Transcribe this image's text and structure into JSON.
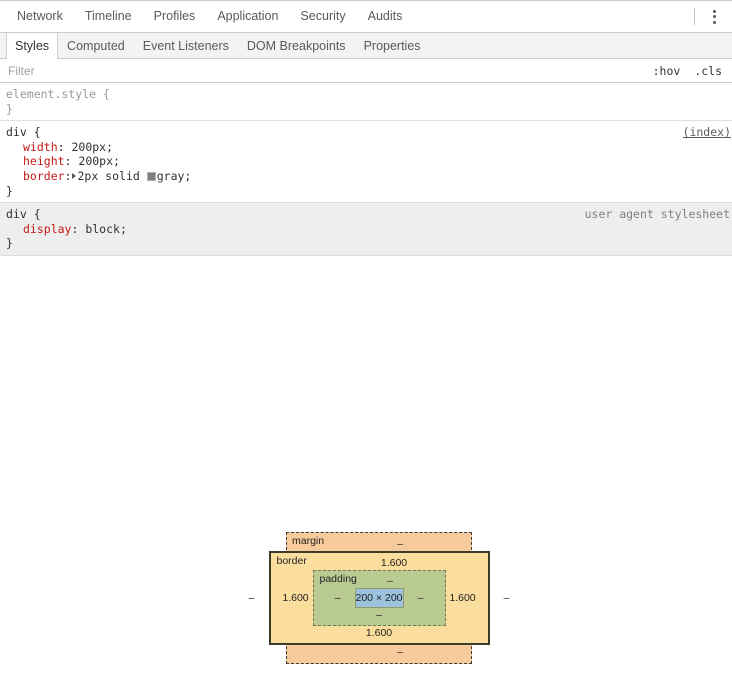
{
  "panel_menu": {
    "items": [
      {
        "label": "Network"
      },
      {
        "label": "Timeline"
      },
      {
        "label": "Profiles"
      },
      {
        "label": "Application"
      },
      {
        "label": "Security"
      },
      {
        "label": "Audits"
      }
    ],
    "more_icon": "kebab-menu-icon"
  },
  "tabs": [
    {
      "label": "Styles",
      "active": true
    },
    {
      "label": "Computed",
      "active": false
    },
    {
      "label": "Event Listeners",
      "active": false
    },
    {
      "label": "DOM Breakpoints",
      "active": false
    },
    {
      "label": "Properties",
      "active": false
    }
  ],
  "filter": {
    "placeholder": "Filter",
    "value": "",
    "hov_label": ":hov",
    "cls_label": ".cls"
  },
  "rules": [
    {
      "selector": "element.style {",
      "close": "}",
      "origin": "",
      "declarations": []
    },
    {
      "selector": "div {",
      "close": "}",
      "origin": "(index)",
      "declarations": [
        {
          "prop": "width",
          "value": "200px;",
          "swatch": false,
          "disclosure": false
        },
        {
          "prop": "height",
          "value": "200px;",
          "swatch": false,
          "disclosure": false
        },
        {
          "prop": "border",
          "value": "2px solid ",
          "value_tail": "gray;",
          "swatch": true,
          "swatch_color": "#808080",
          "disclosure": true
        }
      ]
    },
    {
      "selector": "div {",
      "close": "}",
      "origin": "user agent stylesheet",
      "declarations": [
        {
          "prop": "display",
          "value": "block;",
          "swatch": false,
          "disclosure": false
        }
      ]
    }
  ],
  "box_model": {
    "margin": {
      "label": "margin",
      "top": "–",
      "right": "–",
      "bottom": "–",
      "left": "–"
    },
    "border": {
      "label": "border",
      "top": "1.600",
      "right": "1.600",
      "bottom": "1.600",
      "left": "1.600"
    },
    "padding": {
      "label": "padding",
      "top": "–",
      "right": "–",
      "bottom": "–",
      "left": "–"
    },
    "content": {
      "size": "200 × 200"
    },
    "colors": {
      "margin": "#f8cb9c",
      "border": "#fbdd9e",
      "padding": "#b9cb93",
      "content": "#9cc2dd"
    }
  }
}
